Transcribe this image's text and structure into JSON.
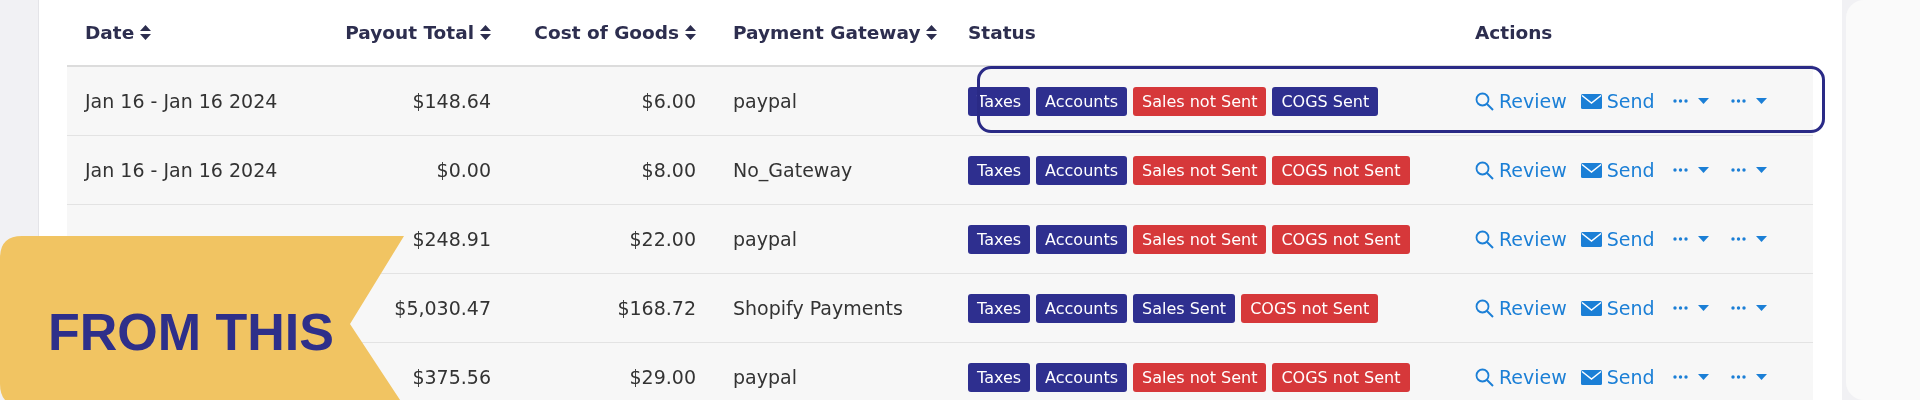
{
  "table": {
    "columns": [
      {
        "label": "Date",
        "sortable": true
      },
      {
        "label": "Payout Total",
        "sortable": true
      },
      {
        "label": "Cost of Goods",
        "sortable": true
      },
      {
        "label": "Payment Gateway",
        "sortable": true
      },
      {
        "label": "Status",
        "sortable": false
      },
      {
        "label": "Actions",
        "sortable": false
      }
    ],
    "rows": [
      {
        "date": "Jan 16 - Jan 16 2024",
        "payout_total": "$148.64",
        "cost_of_goods": "$6.00",
        "gateway": "paypal",
        "highlighted": true,
        "badges": [
          {
            "label": "Taxes",
            "color": "#2e2f8f"
          },
          {
            "label": "Accounts",
            "color": "#2e2f8f"
          },
          {
            "label": "Sales not Sent",
            "color": "#d6383a"
          },
          {
            "label": "COGS Sent",
            "color": "#2e2f8f"
          }
        ],
        "actions": {
          "review": "Review",
          "send": "Send"
        }
      },
      {
        "date": "Jan 16 - Jan 16 2024",
        "payout_total": "$0.00",
        "cost_of_goods": "$8.00",
        "gateway": "No_Gateway",
        "highlighted": false,
        "badges": [
          {
            "label": "Taxes",
            "color": "#2e2f8f"
          },
          {
            "label": "Accounts",
            "color": "#2e2f8f"
          },
          {
            "label": "Sales not Sent",
            "color": "#d6383a"
          },
          {
            "label": "COGS not Sent",
            "color": "#d6383a"
          }
        ],
        "actions": {
          "review": "Review",
          "send": "Send"
        }
      },
      {
        "payout_total": "$248.91",
        "cost_of_goods": "$22.00",
        "gateway": "paypal",
        "highlighted": false,
        "badges": [
          {
            "label": "Taxes",
            "color": "#2e2f8f"
          },
          {
            "label": "Accounts",
            "color": "#2e2f8f"
          },
          {
            "label": "Sales not Sent",
            "color": "#d6383a"
          },
          {
            "label": "COGS not Sent",
            "color": "#d6383a"
          }
        ],
        "actions": {
          "review": "Review",
          "send": "Send"
        }
      },
      {
        "payout_total": "$5,030.47",
        "cost_of_goods": "$168.72",
        "gateway": "Shopify Payments",
        "highlighted": false,
        "badges": [
          {
            "label": "Taxes",
            "color": "#2e2f8f"
          },
          {
            "label": "Accounts",
            "color": "#2e2f8f"
          },
          {
            "label": "Sales Sent",
            "color": "#2e2f8f"
          },
          {
            "label": "COGS not Sent",
            "color": "#d6383a"
          }
        ],
        "actions": {
          "review": "Review",
          "send": "Send"
        }
      },
      {
        "payout_total": "$375.56",
        "cost_of_goods": "$29.00",
        "gateway": "paypal",
        "highlighted": false,
        "badges": [
          {
            "label": "Taxes",
            "color": "#2e2f8f"
          },
          {
            "label": "Accounts",
            "color": "#2e2f8f"
          },
          {
            "label": "Sales not Sent",
            "color": "#d6383a"
          },
          {
            "label": "COGS not Sent",
            "color": "#d6383a"
          }
        ],
        "actions": {
          "review": "Review",
          "send": "Send"
        }
      }
    ]
  },
  "banner": {
    "text": "FROM THIS"
  }
}
